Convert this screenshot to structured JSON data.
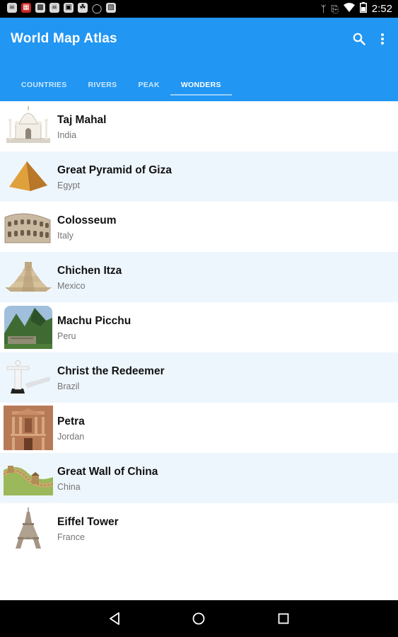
{
  "status_bar": {
    "time": "2:52",
    "left_icons": [
      "skull-icon",
      "news-icon",
      "gallery-icon",
      "skull-icon",
      "photo-icon",
      "leaf-icon",
      "lightbulb-icon",
      "image-icon"
    ],
    "right_icons": [
      "bluetooth-icon",
      "vibrate-icon",
      "wifi-icon",
      "battery-icon"
    ]
  },
  "app_bar": {
    "title": "World Map Atlas",
    "background": "#2196f3",
    "actions": [
      "search-icon",
      "overflow-menu-icon"
    ]
  },
  "tabs": [
    {
      "label": "COUNTRIES",
      "active": false
    },
    {
      "label": "RIVERS",
      "active": false
    },
    {
      "label": "PEAK",
      "active": false
    },
    {
      "label": "WONDERS",
      "active": true
    }
  ],
  "wonders": [
    {
      "name": "Taj Mahal",
      "country": "India",
      "icon": "taj-mahal-icon"
    },
    {
      "name": "Great Pyramid of Giza",
      "country": "Egypt",
      "icon": "pyramid-icon"
    },
    {
      "name": "Colosseum",
      "country": "Italy",
      "icon": "colosseum-icon"
    },
    {
      "name": "Chichen Itza",
      "country": "Mexico",
      "icon": "chichen-itza-icon"
    },
    {
      "name": "Machu Picchu",
      "country": "Peru",
      "icon": "machu-picchu-icon"
    },
    {
      "name": "Christ the Redeemer",
      "country": "Brazil",
      "icon": "christ-statue-icon"
    },
    {
      "name": "Petra",
      "country": "Jordan",
      "icon": "petra-icon"
    },
    {
      "name": "Great Wall of China",
      "country": "China",
      "icon": "great-wall-icon"
    },
    {
      "name": "Eiffel Tower",
      "country": "France",
      "icon": "eiffel-tower-icon"
    }
  ],
  "colors": {
    "accent": "#2196f3",
    "alt_row": "#eef6fd",
    "subtitle": "#757575"
  },
  "nav_bar": [
    "back-icon",
    "home-icon",
    "recents-icon"
  ]
}
